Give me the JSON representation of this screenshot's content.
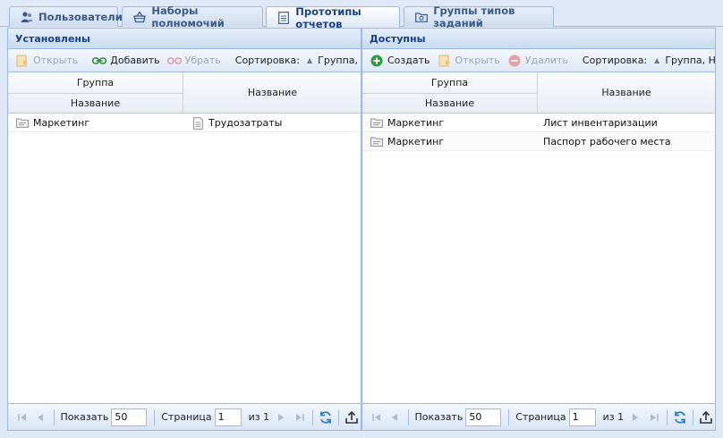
{
  "tabs": [
    {
      "label": "Пользователи",
      "icon": "users-icon",
      "active": false
    },
    {
      "label": "Наборы полномочий",
      "icon": "basket-icon",
      "active": false
    },
    {
      "label": "Прототипы отчетов",
      "icon": "report-icon",
      "active": true
    },
    {
      "label": "Группы типов заданий",
      "icon": "task-group-icon",
      "active": false
    }
  ],
  "left": {
    "title": "Установлены",
    "toolbar": {
      "open": "Открыть",
      "add": "Добавить",
      "remove": "Убрать",
      "sort_label": "Сортировка:",
      "sort_value": "Группа, Название"
    },
    "header": {
      "group": "Группа",
      "name_sub": "Название",
      "name": "Название"
    },
    "rows": [
      {
        "group": "Маркетинг",
        "name": "Трудозатраты"
      }
    ],
    "pager": {
      "show_label": "Показать",
      "page_size": "50",
      "page_label": "Страница",
      "page": "1",
      "of_label": "из 1"
    }
  },
  "right": {
    "title": "Доступны",
    "toolbar": {
      "create": "Создать",
      "open": "Открыть",
      "delete": "Удалить",
      "sort_label": "Сортировка:",
      "sort_value": "Группа, Название"
    },
    "header": {
      "group": "Группа",
      "name_sub": "Название",
      "name": "Название"
    },
    "rows": [
      {
        "group": "Маркетинг",
        "name": "Лист инвентаризации"
      },
      {
        "group": "Маркетинг",
        "name": "Паспорт рабочего места"
      }
    ],
    "pager": {
      "show_label": "Показать",
      "page_size": "50",
      "page_label": "Страница",
      "page": "1",
      "of_label": "из 1"
    }
  },
  "colors": {
    "accent": "#15428b",
    "border": "#99bbe8",
    "create_green": "#2e9e3a",
    "delete_red": "#d9534f"
  }
}
